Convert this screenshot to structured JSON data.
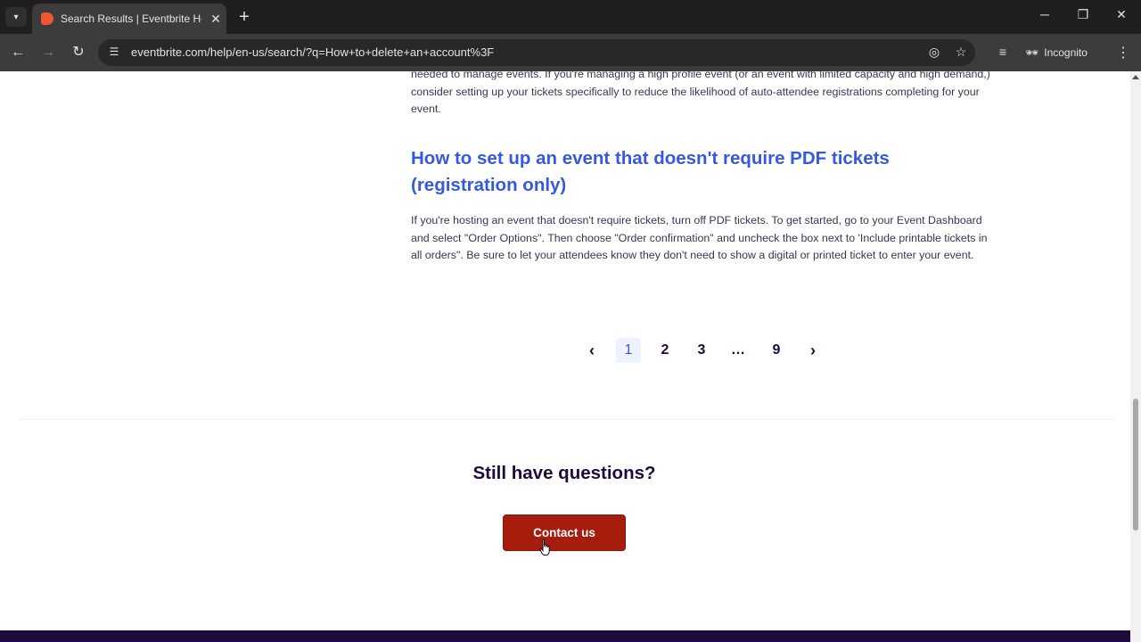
{
  "browser": {
    "tab_title": "Search Results | Eventbrite Help",
    "tab_close": "✕",
    "new_tab": "+",
    "url": "eventbrite.com/help/en-us/search/?q=How+to+delete+an+account%3F",
    "incognito_label": "Incognito",
    "icons": [
      "tab-search-icon",
      "favicon-icon",
      "back-icon",
      "forward-icon",
      "reload-icon",
      "site-info-icon",
      "eye-off-icon",
      "bookmark-star-icon",
      "media-controls-icon",
      "incognito-icon",
      "menu-kebab-icon",
      "minimize-icon",
      "restore-icon",
      "close-icon"
    ]
  },
  "article_prev": {
    "text": "needed to manage events. If you're managing a high profile event (or an event with limited capacity and high demand,) consider setting up your tickets specifically to reduce the likelihood of auto-attendee registrations completing for your event."
  },
  "article": {
    "title": "How to set up an event that doesn't require PDF tickets (registration only)",
    "body": "If you're hosting an event that doesn't require tickets, turn off PDF tickets. To get started, go to your Event Dashboard and select \"Order Options\". Then choose \"Order confirmation\" and uncheck the box next to 'Include printable tickets in all orders\". Be sure to let your attendees know they don't need to show a digital or printed ticket to enter your event."
  },
  "pagination": {
    "pages": [
      "1",
      "2",
      "3",
      "…",
      "9"
    ],
    "current": "1"
  },
  "help_footer": {
    "heading": "Still have questions?",
    "contact_label": "Contact us"
  },
  "colors": {
    "link_blue": "#3659e3",
    "brand_button": "#a61c0d",
    "heading_dark": "#1e0a3c"
  }
}
